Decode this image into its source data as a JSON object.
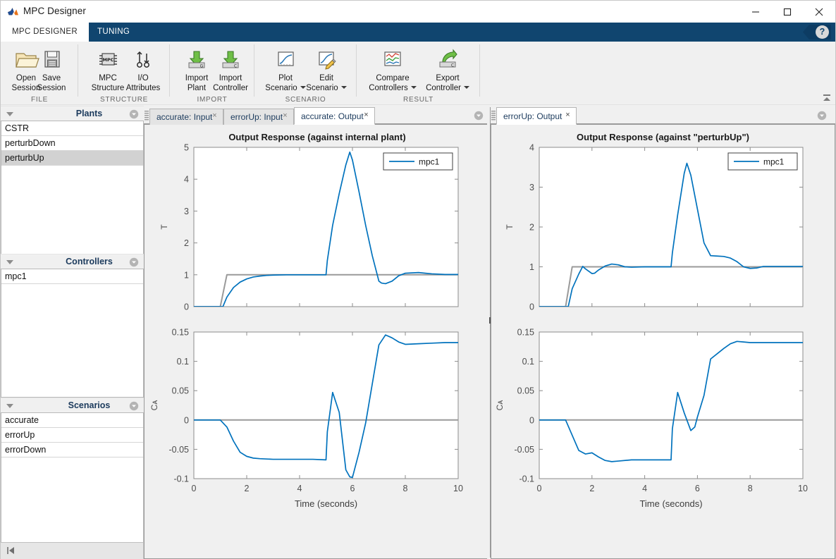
{
  "window": {
    "title": "MPC Designer",
    "minimize_label": "Minimize",
    "maximize_label": "Maximize",
    "close_label": "Close"
  },
  "ribbon": {
    "tabs": [
      {
        "label": "MPC DESIGNER",
        "active": true
      },
      {
        "label": "TUNING",
        "active": false
      }
    ],
    "help_label": "?",
    "collapse_label": "Minimize Ribbon",
    "groups": [
      {
        "label": "FILE",
        "buttons": [
          {
            "label_line1": "Open",
            "label_line2": "Session",
            "icon": "open-folder-icon",
            "dropdown": false
          },
          {
            "label_line1": "Save",
            "label_line2": "Session",
            "icon": "floppy-disk-icon",
            "dropdown": false
          }
        ]
      },
      {
        "label": "STRUCTURE",
        "buttons": [
          {
            "label_line1": "MPC",
            "label_line2": "Structure",
            "icon": "mpc-chip-icon",
            "dropdown": false
          },
          {
            "label_line1": "I/O",
            "label_line2": "Attributes",
            "icon": "io-attributes-icon",
            "dropdown": false
          }
        ]
      },
      {
        "label": "IMPORT",
        "buttons": [
          {
            "label_line1": "Import",
            "label_line2": "Plant",
            "icon": "import-plant-icon",
            "dropdown": false
          },
          {
            "label_line1": "Import",
            "label_line2": "Controller",
            "icon": "import-controller-icon",
            "dropdown": false
          }
        ]
      },
      {
        "label": "SCENARIO",
        "buttons": [
          {
            "label_line1": "Plot",
            "label_line2": "Scenario",
            "icon": "plot-scenario-icon",
            "dropdown": true
          },
          {
            "label_line1": "Edit",
            "label_line2": "Scenario",
            "icon": "edit-scenario-icon",
            "dropdown": true
          }
        ]
      },
      {
        "label": "RESULT",
        "buttons": [
          {
            "label_line1": "Compare",
            "label_line2": "Controllers",
            "icon": "compare-controllers-icon",
            "dropdown": true
          },
          {
            "label_line1": "Export",
            "label_line2": "Controller",
            "icon": "export-controller-icon",
            "dropdown": true
          }
        ]
      }
    ]
  },
  "sidebar": {
    "panels": [
      {
        "title": "Plants",
        "menu_icon": "panel-menu-icon",
        "collapse_icon": "collapse-triangle-icon",
        "items": [
          {
            "label": "CSTR",
            "selected": false
          },
          {
            "label": "perturbDown",
            "selected": false
          },
          {
            "label": "perturbUp",
            "selected": true
          }
        ]
      },
      {
        "title": "Controllers",
        "menu_icon": "panel-menu-icon",
        "collapse_icon": "collapse-triangle-icon",
        "items": [
          {
            "label": "mpc1",
            "selected": false
          }
        ]
      },
      {
        "title": "Scenarios",
        "menu_icon": "panel-menu-icon",
        "collapse_icon": "collapse-triangle-icon",
        "items": [
          {
            "label": "accurate",
            "selected": false
          },
          {
            "label": "errorUp",
            "selected": false
          },
          {
            "label": "errorDown",
            "selected": false
          }
        ]
      }
    ],
    "status_icon": "collapse-pane-icon"
  },
  "doc_panes": [
    {
      "name": "left-doc-pane",
      "tabs": [
        {
          "label": "accurate: Input",
          "active": false,
          "close_label": "×"
        },
        {
          "label": "errorUp: Input",
          "active": false,
          "close_label": "×"
        },
        {
          "label": "accurate: Output",
          "active": true,
          "close_label": "×"
        }
      ],
      "tab_menu_icon": "tab-overflow-icon"
    },
    {
      "name": "right-doc-pane",
      "tabs": [
        {
          "label": "errorUp: Output",
          "active": true,
          "close_label": "×"
        }
      ],
      "tab_menu_icon": "tab-overflow-icon"
    }
  ],
  "colors": {
    "accent_blue": "#0072BD",
    "reference_gray": "#9a9a9a",
    "ribbon_blue": "#10456f",
    "selection_gray": "#d2d2d2"
  },
  "chart_data": [
    {
      "id": "left-top",
      "type": "line",
      "title": "Output Response (against internal plant)",
      "xlabel": "",
      "ylabel": "T",
      "xlim": [
        0,
        10
      ],
      "ylim": [
        0,
        5
      ],
      "xticks": [
        0,
        2,
        4,
        6,
        8,
        10
      ],
      "yticks": [
        0,
        1,
        2,
        3,
        4,
        5
      ],
      "grid": false,
      "legend": {
        "position": "top-right",
        "entries": [
          "mpc1"
        ]
      },
      "series": [
        {
          "name": "reference",
          "color": "#9a9a9a",
          "x": [
            0,
            1.0,
            1.25,
            10
          ],
          "y": [
            0,
            0,
            1,
            1
          ]
        },
        {
          "name": "mpc1",
          "color": "#0072BD",
          "x": [
            0,
            0.25,
            0.5,
            0.75,
            1.0,
            1.1,
            1.25,
            1.5,
            1.75,
            2.0,
            2.25,
            2.5,
            2.75,
            3.0,
            3.5,
            4.0,
            4.5,
            5.0,
            5.05,
            5.25,
            5.5,
            5.75,
            5.9,
            6.0,
            6.25,
            6.5,
            6.75,
            7.0,
            7.1,
            7.25,
            7.5,
            7.75,
            8.0,
            8.5,
            9.0,
            9.5,
            10.0
          ],
          "y": [
            0,
            0,
            0,
            0,
            0,
            0.0,
            0.3,
            0.6,
            0.77,
            0.87,
            0.93,
            0.96,
            0.98,
            0.99,
            1.0,
            1.0,
            1.0,
            1.0,
            1.45,
            2.55,
            3.55,
            4.45,
            4.85,
            4.6,
            3.6,
            2.55,
            1.6,
            0.8,
            0.74,
            0.72,
            0.8,
            0.97,
            1.05,
            1.07,
            1.03,
            1.01,
            1.01
          ]
        }
      ]
    },
    {
      "id": "left-bottom",
      "type": "line",
      "title": "",
      "xlabel": "Time (seconds)",
      "ylabel": "Cᴀ",
      "xlim": [
        0,
        10
      ],
      "ylim": [
        -0.1,
        0.15
      ],
      "xticks": [
        0,
        2,
        4,
        6,
        8,
        10
      ],
      "yticks": [
        -0.1,
        -0.05,
        0,
        0.05,
        0.1,
        0.15
      ],
      "grid": false,
      "legend": null,
      "series": [
        {
          "name": "reference",
          "color": "#9a9a9a",
          "x": [
            0,
            10
          ],
          "y": [
            0,
            0
          ]
        },
        {
          "name": "mpc1",
          "color": "#0072BD",
          "x": [
            0,
            0.5,
            1.0,
            1.25,
            1.5,
            1.75,
            2.0,
            2.25,
            2.5,
            3.0,
            3.5,
            4.0,
            4.5,
            5.0,
            5.05,
            5.25,
            5.5,
            5.75,
            5.9,
            6.0,
            6.25,
            6.5,
            7.0,
            7.25,
            7.5,
            7.75,
            8.0,
            8.5,
            9.0,
            9.5,
            10.0
          ],
          "y": [
            0,
            0,
            0,
            -0.012,
            -0.036,
            -0.055,
            -0.062,
            -0.065,
            -0.066,
            -0.067,
            -0.067,
            -0.067,
            -0.067,
            -0.068,
            -0.02,
            0.047,
            0.013,
            -0.085,
            -0.097,
            -0.098,
            -0.055,
            -0.005,
            0.128,
            0.145,
            0.14,
            0.133,
            0.129,
            0.13,
            0.131,
            0.132,
            0.132
          ]
        }
      ]
    },
    {
      "id": "right-top",
      "type": "line",
      "title": "Output Response (against \"perturbUp\")",
      "xlabel": "",
      "ylabel": "T",
      "xlim": [
        0,
        10
      ],
      "ylim": [
        0,
        4
      ],
      "xticks": [
        0,
        2,
        4,
        6,
        8,
        10
      ],
      "yticks": [
        0,
        1,
        2,
        3,
        4
      ],
      "grid": false,
      "legend": {
        "position": "top-right",
        "entries": [
          "mpc1"
        ]
      },
      "series": [
        {
          "name": "reference",
          "color": "#9a9a9a",
          "x": [
            0,
            1.0,
            1.25,
            10
          ],
          "y": [
            0,
            0,
            1,
            1
          ]
        },
        {
          "name": "mpc1",
          "color": "#0072BD",
          "x": [
            0,
            0.5,
            1.0,
            1.1,
            1.25,
            1.5,
            1.65,
            1.75,
            2.0,
            2.1,
            2.25,
            2.5,
            2.75,
            3.0,
            3.25,
            3.5,
            4.0,
            4.5,
            5.0,
            5.05,
            5.25,
            5.5,
            5.6,
            5.75,
            6.0,
            6.25,
            6.5,
            6.75,
            7.0,
            7.25,
            7.5,
            7.75,
            8.0,
            8.25,
            8.5,
            9.0,
            9.5,
            10.0
          ],
          "y": [
            0,
            0,
            0,
            0.0,
            0.45,
            0.82,
            1.01,
            0.95,
            0.83,
            0.84,
            0.92,
            1.02,
            1.07,
            1.05,
            1.0,
            0.99,
            1.0,
            1.0,
            1.0,
            1.35,
            2.3,
            3.35,
            3.6,
            3.3,
            2.45,
            1.6,
            1.28,
            1.27,
            1.26,
            1.22,
            1.13,
            1.0,
            0.96,
            0.97,
            1.01,
            1.01,
            1.01,
            1.01
          ]
        }
      ]
    },
    {
      "id": "right-bottom",
      "type": "line",
      "title": "",
      "xlabel": "Time (seconds)",
      "ylabel": "Cᴀ",
      "xlim": [
        0,
        10
      ],
      "ylim": [
        -0.1,
        0.15
      ],
      "xticks": [
        0,
        2,
        4,
        6,
        8,
        10
      ],
      "yticks": [
        -0.1,
        -0.05,
        0,
        0.05,
        0.1,
        0.15
      ],
      "grid": false,
      "legend": null,
      "series": [
        {
          "name": "reference",
          "color": "#9a9a9a",
          "x": [
            0,
            10
          ],
          "y": [
            0,
            0
          ]
        },
        {
          "name": "mpc1",
          "color": "#0072BD",
          "x": [
            0,
            0.5,
            1.0,
            1.25,
            1.5,
            1.75,
            2.0,
            2.25,
            2.5,
            2.75,
            3.0,
            3.5,
            4.0,
            4.5,
            5.0,
            5.05,
            5.25,
            5.5,
            5.75,
            5.9,
            6.0,
            6.25,
            6.5,
            6.75,
            7.0,
            7.25,
            7.5,
            7.75,
            8.0,
            8.5,
            9.0,
            9.5,
            10.0
          ],
          "y": [
            0,
            0,
            0,
            -0.026,
            -0.052,
            -0.058,
            -0.056,
            -0.063,
            -0.069,
            -0.071,
            -0.07,
            -0.068,
            -0.068,
            -0.068,
            -0.068,
            -0.015,
            0.047,
            0.012,
            -0.018,
            -0.012,
            0.005,
            0.042,
            0.104,
            0.113,
            0.122,
            0.13,
            0.134,
            0.133,
            0.132,
            0.132,
            0.132,
            0.132,
            0.132
          ]
        }
      ]
    }
  ]
}
